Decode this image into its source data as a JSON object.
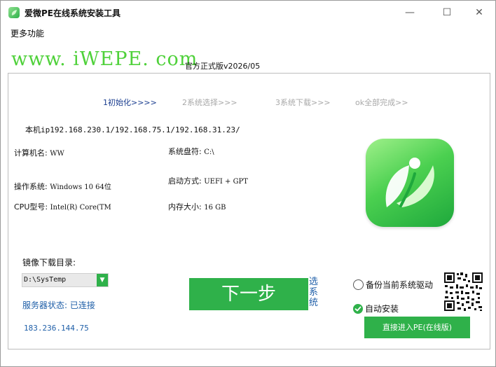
{
  "window": {
    "title": "爱微PE在线系统安装工具",
    "minimize": "—",
    "maximize": "☐",
    "close": "✕"
  },
  "menu": {
    "more_functions": "更多功能"
  },
  "header": {
    "site": "www. iWEPE. com",
    "version": "官方正式版v2026/05"
  },
  "steps": {
    "step1": "1初始化>>>>",
    "step2": "2系统选择>>>",
    "step3": "3系统下载>>>",
    "step4": "ok全部完成>>"
  },
  "machine": {
    "ip": "本机ip192.168.230.1/192.168.75.1/192.168.31.23/",
    "computer_name_label": "计算机名:",
    "computer_name": "WW",
    "system_drive_label": "系统盘符:",
    "system_drive": "C:\\",
    "os_label": "操作系统:",
    "os": "Windows 10 64位",
    "boot_label": "启动方式:",
    "boot": "UEFI + GPT",
    "cpu_label": "CPU型号:",
    "cpu": "Intel(R) Core(TM",
    "memory_label": "内存大小:",
    "memory": "16 GB"
  },
  "download": {
    "dir_label": "镜像下载目录:",
    "dir_value": "D:\\SysTemp",
    "server_status": "服务器状态: 已连接",
    "server_ip": "183.236.144.75"
  },
  "actions": {
    "next": "下一步",
    "select_system": "选系统",
    "backup_driver": "备份当前系统驱动",
    "auto_install": "自动安装",
    "enter_pe": "直接进入PE(在线版)"
  },
  "colors": {
    "brand_green": "#2fb14a",
    "site_green": "#4fd13a",
    "link_blue": "#1f5fa8",
    "active_step": "#1a3d8f",
    "inactive_step": "#a8a8a8"
  },
  "icons": {
    "app": "iwepe-leaf-icon",
    "logo": "iwepe-logo-icon",
    "qr": "qr-code-icon",
    "dropdown": "chevron-down-icon",
    "check": "check-circle-icon",
    "radio": "radio-circle-icon"
  }
}
